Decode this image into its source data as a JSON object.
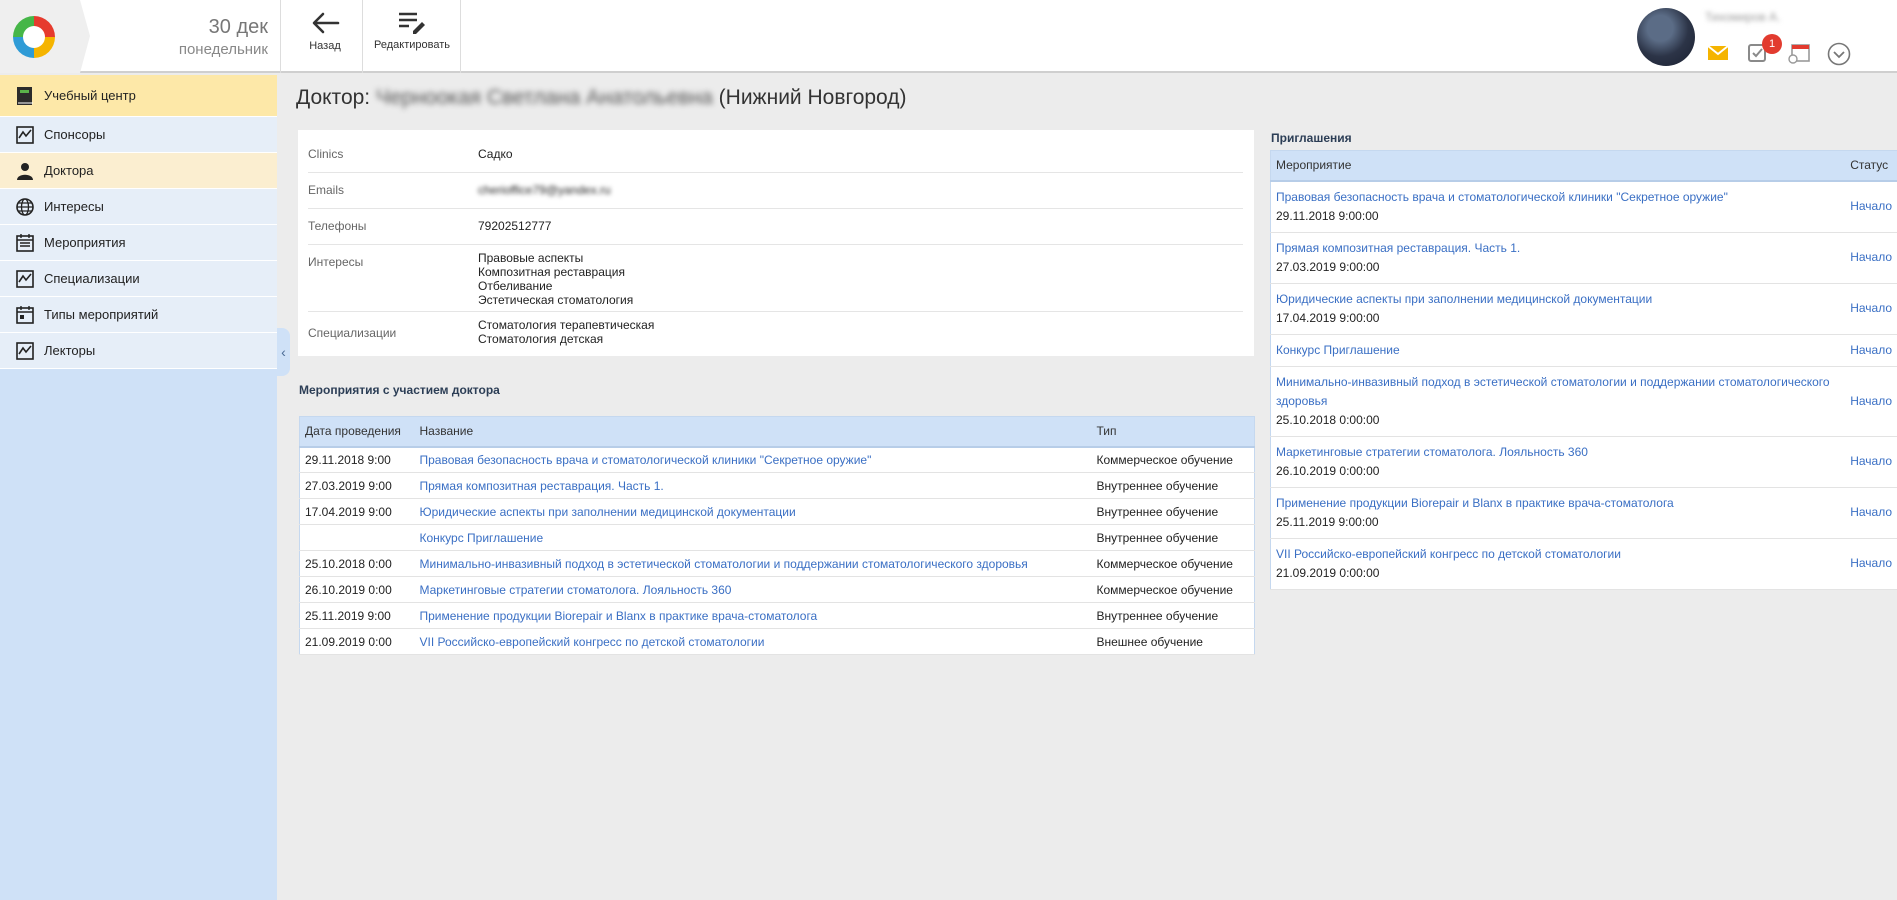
{
  "header": {
    "date_day": "30 дек",
    "date_weekday": "понедельник",
    "back_label": "Назад",
    "edit_label": "Редактировать",
    "user_name": "Тихомиров А.",
    "tasks_badge": "1"
  },
  "sidebar": {
    "items": [
      {
        "label": "Учебный центр",
        "icon": "book-icon"
      },
      {
        "label": "Спонсоры",
        "icon": "chart-icon"
      },
      {
        "label": "Доктора",
        "icon": "doctor-icon"
      },
      {
        "label": "Интересы",
        "icon": "globe-icon"
      },
      {
        "label": "Мероприятия",
        "icon": "calendar-list-icon"
      },
      {
        "label": "Специализации",
        "icon": "chart-icon"
      },
      {
        "label": "Типы мероприятий",
        "icon": "calendar-icon"
      },
      {
        "label": "Лекторы",
        "icon": "chart-icon"
      }
    ]
  },
  "page": {
    "title_prefix": "Доктор:",
    "doctor_name": "Черноокая Светлана Анатольевна",
    "city": "(Нижний Новгород)"
  },
  "info": {
    "clinics_label": "Clinics",
    "clinics_value": "Садко",
    "emails_label": "Emails",
    "emails_value": "cherioffice79@yandex.ru",
    "phones_label": "Телефоны",
    "phones_value": "79202512777",
    "interests_label": "Интересы",
    "interests": [
      "Правовые аспекты",
      "Композитная реставрация",
      "Отбеливание",
      "Эстетическая стоматология"
    ],
    "spec_label": "Специализации",
    "specializations": [
      "Стоматология терапевтическая",
      "Стоматология детская"
    ]
  },
  "events": {
    "title": "Мероприятия с участием доктора",
    "headers": {
      "date": "Дата проведения",
      "name": "Название",
      "type": "Тип"
    },
    "rows": [
      {
        "date": "29.11.2018 9:00",
        "name": "Правовая безопасность врача и стоматологической клиники \"Секретное оружие\"",
        "type": "Коммерческое обучение"
      },
      {
        "date": "27.03.2019 9:00",
        "name": "Прямая композитная реставрация. Часть 1.",
        "type": "Внутреннее обучение"
      },
      {
        "date": "17.04.2019 9:00",
        "name": "Юридические аспекты при заполнении медицинской документации",
        "type": "Внутреннее обучение"
      },
      {
        "date": "",
        "name": "Конкурс Приглашение",
        "type": "Внутреннее обучение"
      },
      {
        "date": "25.10.2018 0:00",
        "name": "Минимально-инвазивный подход в эстетической стоматологии и поддержании стоматологического здоровья",
        "type": "Коммерческое обучение"
      },
      {
        "date": "26.10.2019 0:00",
        "name": "Маркетинговые стратегии стоматолога. Лояльность 360",
        "type": "Коммерческое обучение"
      },
      {
        "date": "25.11.2019 9:00",
        "name": "Применение продукции Biorepair и Blanx в практике врача-стоматолога",
        "type": "Внутреннее обучение"
      },
      {
        "date": "21.09.2019 0:00",
        "name": "VII Российско-европейский конгресс по детской стоматологии",
        "type": "Внешнее обучение"
      }
    ]
  },
  "invitations": {
    "title": "Приглашения",
    "headers": {
      "event": "Мероприятие",
      "status": "Статус"
    },
    "rows": [
      {
        "name": "Правовая безопасность врача и стоматологической клиники \"Секретное оружие\"",
        "date": "29.11.2018 9:00:00",
        "status": "Начало"
      },
      {
        "name": "Прямая композитная реставрация. Часть 1.",
        "date": "27.03.2019 9:00:00",
        "status": "Начало"
      },
      {
        "name": "Юридические аспекты при заполнении медицинской документации",
        "date": "17.04.2019 9:00:00",
        "status": "Начало"
      },
      {
        "name": "Конкурс Приглашение",
        "date": "",
        "status": "Начало"
      },
      {
        "name": "Минимально-инвазивный подход в эстетической стоматологии и поддержании стоматологического здоровья",
        "date": "25.10.2018 0:00:00",
        "status": "Начало"
      },
      {
        "name": "Маркетинговые стратегии стоматолога. Лояльность 360",
        "date": "26.10.2019 0:00:00",
        "status": "Начало"
      },
      {
        "name": "Применение продукции Biorepair и Blanx в практике врача-стоматолога",
        "date": "25.11.2019 9:00:00",
        "status": "Начало"
      },
      {
        "name": "VII Российско-европейский конгресс по детской стоматологии",
        "date": "21.09.2019 0:00:00",
        "status": "Начало"
      }
    ]
  }
}
